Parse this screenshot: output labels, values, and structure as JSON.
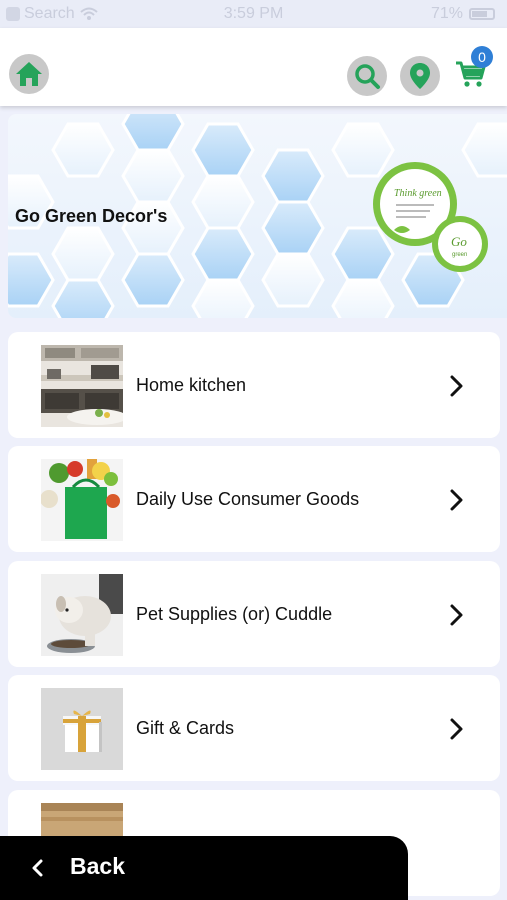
{
  "status_bar": {
    "carrier": "Search",
    "time": "3:59 PM",
    "battery": "71%"
  },
  "header": {
    "cart_count": "0",
    "icons": [
      "home-icon",
      "search-icon",
      "location-pin-icon",
      "cart-icon"
    ]
  },
  "banner": {
    "title": "Go Green Decor's",
    "art_text_top": "Think green",
    "art_text_bottom": "Go",
    "art_text_bottom_small": "green"
  },
  "categories": [
    {
      "label": "Home kitchen",
      "image": "kitchen-photo"
    },
    {
      "label": "Daily Use Consumer Goods",
      "image": "grocery-bag-photo"
    },
    {
      "label": "Pet Supplies (or) Cuddle",
      "image": "puppy-photo"
    },
    {
      "label": "Gift & Cards",
      "image": "gift-box-photo"
    },
    {
      "label": "",
      "image": "wood-photo"
    }
  ],
  "footer": {
    "back_label": "Back"
  },
  "colors": {
    "accent_green": "#25a35a",
    "badge_blue": "#2f7fd6",
    "background": "#eef0fb"
  }
}
